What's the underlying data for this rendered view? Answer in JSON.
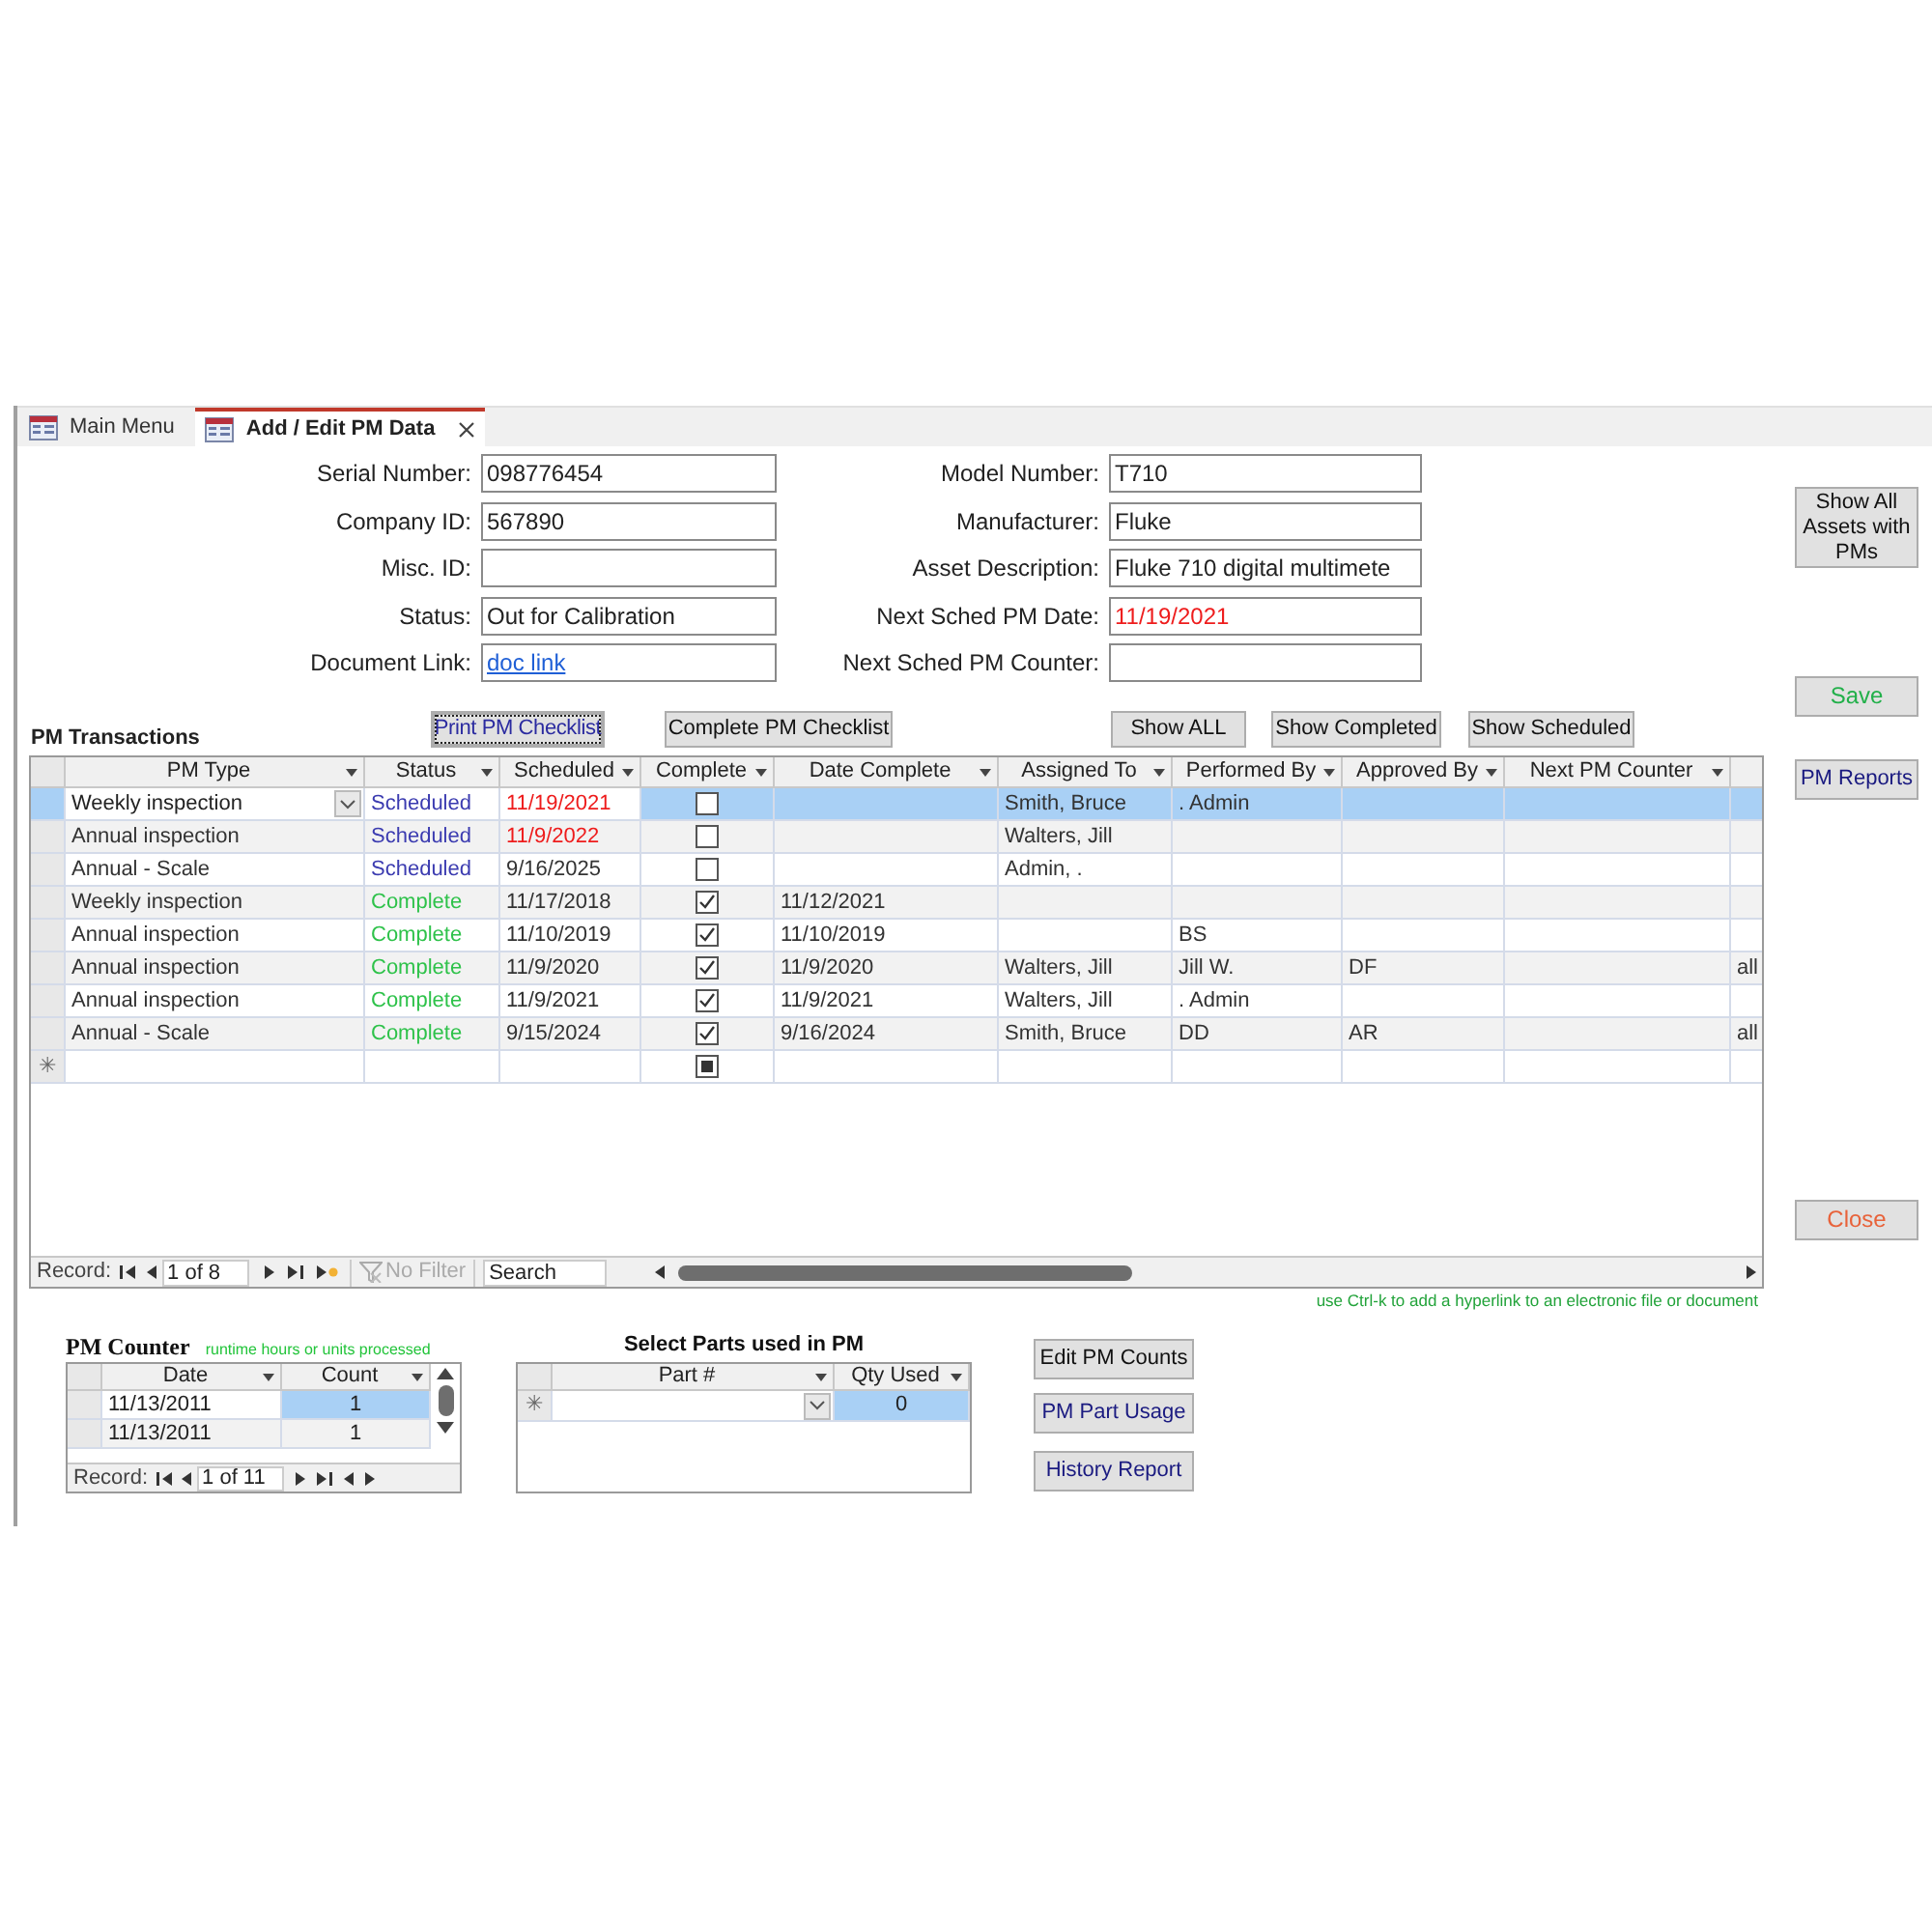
{
  "tabs": [
    {
      "label": "Main Menu",
      "selected": false,
      "closable": false
    },
    {
      "label": "Add / Edit PM Data",
      "selected": true,
      "closable": true
    }
  ],
  "fields": [
    {
      "label": "Serial Number:",
      "value": "098776454",
      "kind": "text"
    },
    {
      "label": "Model Number:",
      "value": "T710",
      "kind": "text"
    },
    {
      "label": "Company ID:",
      "value": "567890",
      "kind": "text"
    },
    {
      "label": "Manufacturer:",
      "value": "Fluke",
      "kind": "text"
    },
    {
      "label": "Misc. ID:",
      "kind": "text"
    },
    {
      "label": "Asset Description:",
      "value": "Fluke 710 digital multimete",
      "kind": "text"
    },
    {
      "label": "Status:",
      "value": "Out for Calibration",
      "kind": "text"
    },
    {
      "label": "Next Sched PM Date:",
      "value": "11/19/2021",
      "kind": "alert"
    },
    {
      "label": "Document Link:",
      "value": "doc link",
      "kind": "link"
    },
    {
      "label": "Next Sched PM Counter:",
      "kind": "text"
    }
  ],
  "section_title": "PM Transactions",
  "checklist_buttons": [
    {
      "label": "Print PM Checklist",
      "focused": true,
      "color": "#2b2ba0"
    },
    {
      "label": "Complete PM Checklist",
      "focused": false,
      "color": "#111111"
    }
  ],
  "filter_buttons": [
    {
      "label": "Show ALL"
    },
    {
      "label": "Show Completed"
    },
    {
      "label": "Show Scheduled"
    }
  ],
  "side_buttons": [
    {
      "label": "Show All Assets with PMs",
      "color": "#111111"
    },
    {
      "label": "Save",
      "color": "#22b04a"
    },
    {
      "label": "PM Reports",
      "color": "#1a1a80"
    },
    {
      "label": "Close",
      "color": "#e8623a"
    }
  ],
  "transactions": {
    "columns": [
      "PM Type",
      "Status",
      "Scheduled",
      "Complete",
      "Date Complete",
      "Assigned To",
      "Performed By",
      "Approved By",
      "Next PM Counter"
    ],
    "rows": [
      {
        "selected": true,
        "pm_type": "Weekly inspection",
        "status": {
          "text": "Scheduled",
          "color": "#3b3bb0"
        },
        "scheduled": {
          "text": "11/19/2021",
          "overdue": true
        },
        "complete": false,
        "assigned_to": "Smith, Bruce",
        "performed_by": ". Admin"
      },
      {
        "selected": false,
        "pm_type": "Annual inspection",
        "status": {
          "text": "Scheduled",
          "color": "#3b3bb0"
        },
        "scheduled": {
          "text": "11/9/2022",
          "overdue": true
        },
        "complete": false,
        "assigned_to": "Walters, Jill"
      },
      {
        "selected": false,
        "pm_type": "Annual - Scale",
        "status": {
          "text": "Scheduled",
          "color": "#3b3bb0"
        },
        "scheduled": {
          "text": "9/16/2025",
          "overdue": false
        },
        "complete": false,
        "assigned_to": "Admin, ."
      },
      {
        "selected": false,
        "pm_type": "Weekly inspection",
        "status": {
          "text": "Complete",
          "color": "#2ec24a"
        },
        "scheduled": {
          "text": "11/17/2018",
          "overdue": false
        },
        "complete": true,
        "date_complete": "11/12/2021"
      },
      {
        "selected": false,
        "pm_type": "Annual inspection",
        "status": {
          "text": "Complete",
          "color": "#2ec24a"
        },
        "scheduled": {
          "text": "11/10/2019",
          "overdue": false
        },
        "complete": true,
        "date_complete": "11/10/2019",
        "performed_by": "BS"
      },
      {
        "selected": false,
        "pm_type": "Annual inspection",
        "status": {
          "text": "Complete",
          "color": "#2ec24a"
        },
        "scheduled": {
          "text": "11/9/2020",
          "overdue": false
        },
        "complete": true,
        "date_complete": "11/9/2020",
        "assigned_to": "Walters, Jill",
        "performed_by": "Jill W.",
        "approved_by": "DF",
        "column_11": "all"
      },
      {
        "selected": false,
        "pm_type": "Annual inspection",
        "status": {
          "text": "Complete",
          "color": "#2ec24a"
        },
        "scheduled": {
          "text": "11/9/2021",
          "overdue": false
        },
        "complete": true,
        "date_complete": "11/9/2021",
        "assigned_to": "Walters, Jill",
        "performed_by": ". Admin"
      },
      {
        "selected": false,
        "pm_type": "Annual - Scale",
        "status": {
          "text": "Complete",
          "color": "#2ec24a"
        },
        "scheduled": {
          "text": "9/15/2024",
          "overdue": false
        },
        "complete": true,
        "date_complete": "9/16/2024",
        "assigned_to": "Smith, Bruce",
        "performed_by": "DD",
        "approved_by": "AR",
        "column_11": "all"
      }
    ],
    "new_row_marker": "✳",
    "new_row_complete_indeterminate": true,
    "navigator": {
      "label": "Record:",
      "position": "1 of 8",
      "filter": "No Filter",
      "search": "Search"
    }
  },
  "hint": "use Ctrl-k to add a hyperlink to an electronic file or document",
  "pm_counter": {
    "title": "PM Counter",
    "subtitle": "runtime hours or units processed",
    "columns": [
      "Date",
      "Count"
    ],
    "rows": [
      {
        "date": "11/13/2011",
        "count": "1",
        "selected": true
      },
      {
        "date": "11/13/2011",
        "count": "1",
        "selected": false
      }
    ],
    "navigator": {
      "label": "Record:",
      "position": "1 of 11"
    }
  },
  "parts": {
    "title": "Select Parts used in PM",
    "columns": [
      "Part #",
      "Qty Used"
    ],
    "new_row": {
      "marker": "✳",
      "qty": "0"
    }
  },
  "bottom_buttons": [
    {
      "label": "Edit PM Counts",
      "color": "#111111"
    },
    {
      "label": "PM Part Usage",
      "color": "#1a1a80"
    },
    {
      "label": "History Report",
      "color": "#1a1a80"
    }
  ]
}
